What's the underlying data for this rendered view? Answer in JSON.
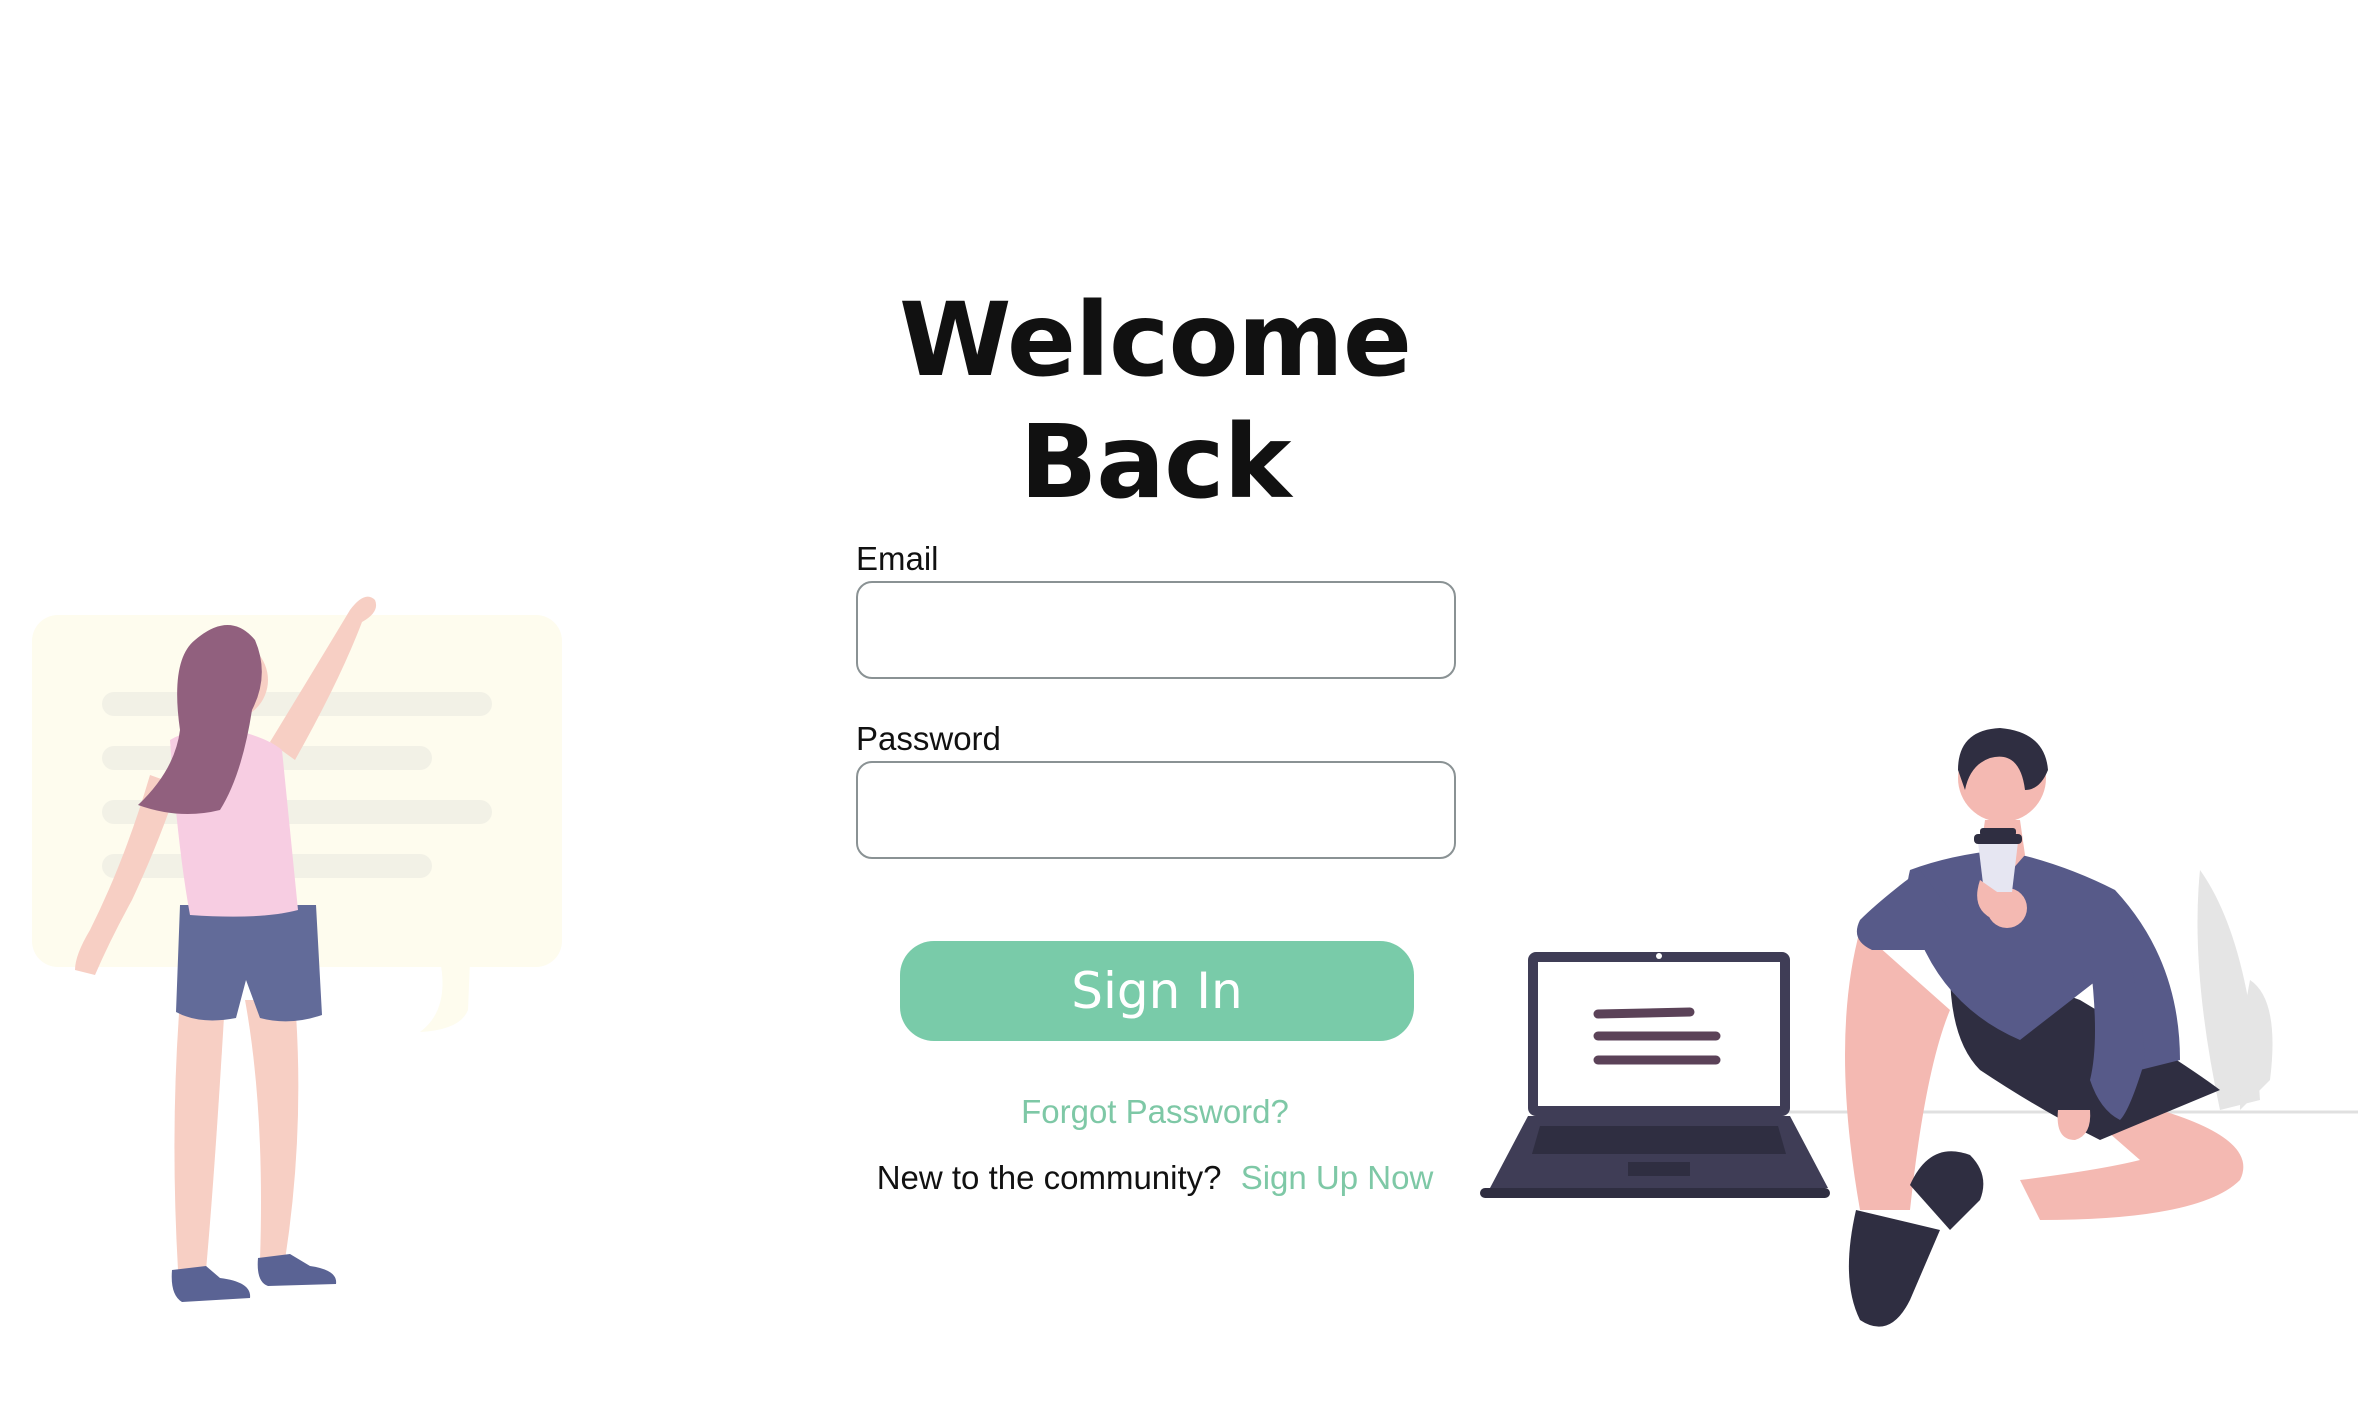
{
  "login": {
    "title": "Welcome Back",
    "email_label": "Email",
    "email_value": "",
    "password_label": "Password",
    "password_value": "",
    "signin_label": "Sign In",
    "forgot_label": "Forgot Password?",
    "signup_prompt": "New to the community?",
    "signup_label": "Sign Up Now"
  },
  "colors": {
    "accent": "#79cba9",
    "link": "#7ec8a6",
    "title": "#111111",
    "input_border": "#8a9294"
  },
  "illustrations": {
    "left": "woman-reaching-chat-bubble",
    "right": "man-sitting-with-coffee-and-laptop"
  }
}
